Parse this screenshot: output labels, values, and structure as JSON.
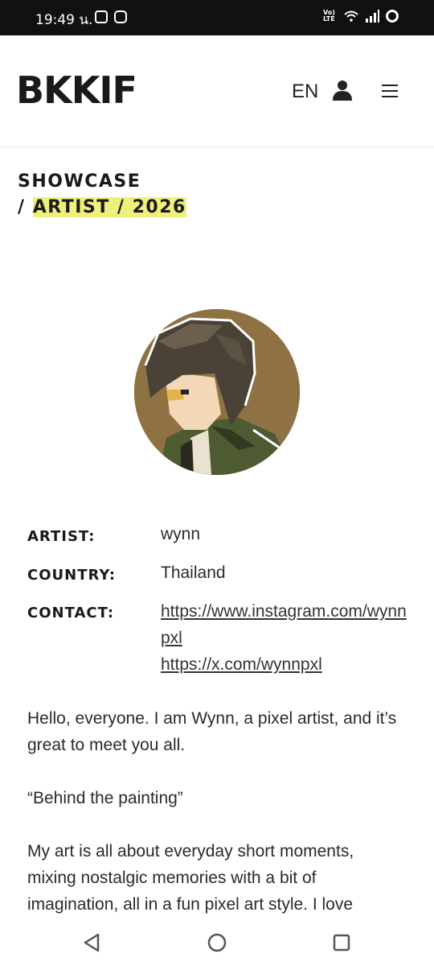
{
  "status_bar": {
    "time": "19:49 น.",
    "volte": "Vo) LTE"
  },
  "header": {
    "logo": "BKKIF",
    "language": "EN"
  },
  "heading": {
    "line1": "SHOWCASE",
    "separator": "/",
    "highlight": "ARTIST / 2026"
  },
  "details": {
    "artist_label": "ARTIST:",
    "artist_value": "wynn",
    "country_label": "COUNTRY:",
    "country_value": "Thailand",
    "contact_label": "CONTACT:",
    "contact_links": [
      "https://www.instagram.com/wynnpxl",
      "https://x.com/wynnpxl"
    ]
  },
  "bio": {
    "paragraphs": [
      "Hello, everyone. I am Wynn, a pixel artist, and it’s great to meet you all.",
      "“Behind the painting”",
      "My art is all about everyday short moments, mixing nostalgic memories with a bit of imagination, all in a fun pixel art style. I love"
    ]
  },
  "colors": {
    "highlight": "#eef07a",
    "avatar_bg": "#8f7243",
    "status_bar_bg": "#111111"
  }
}
